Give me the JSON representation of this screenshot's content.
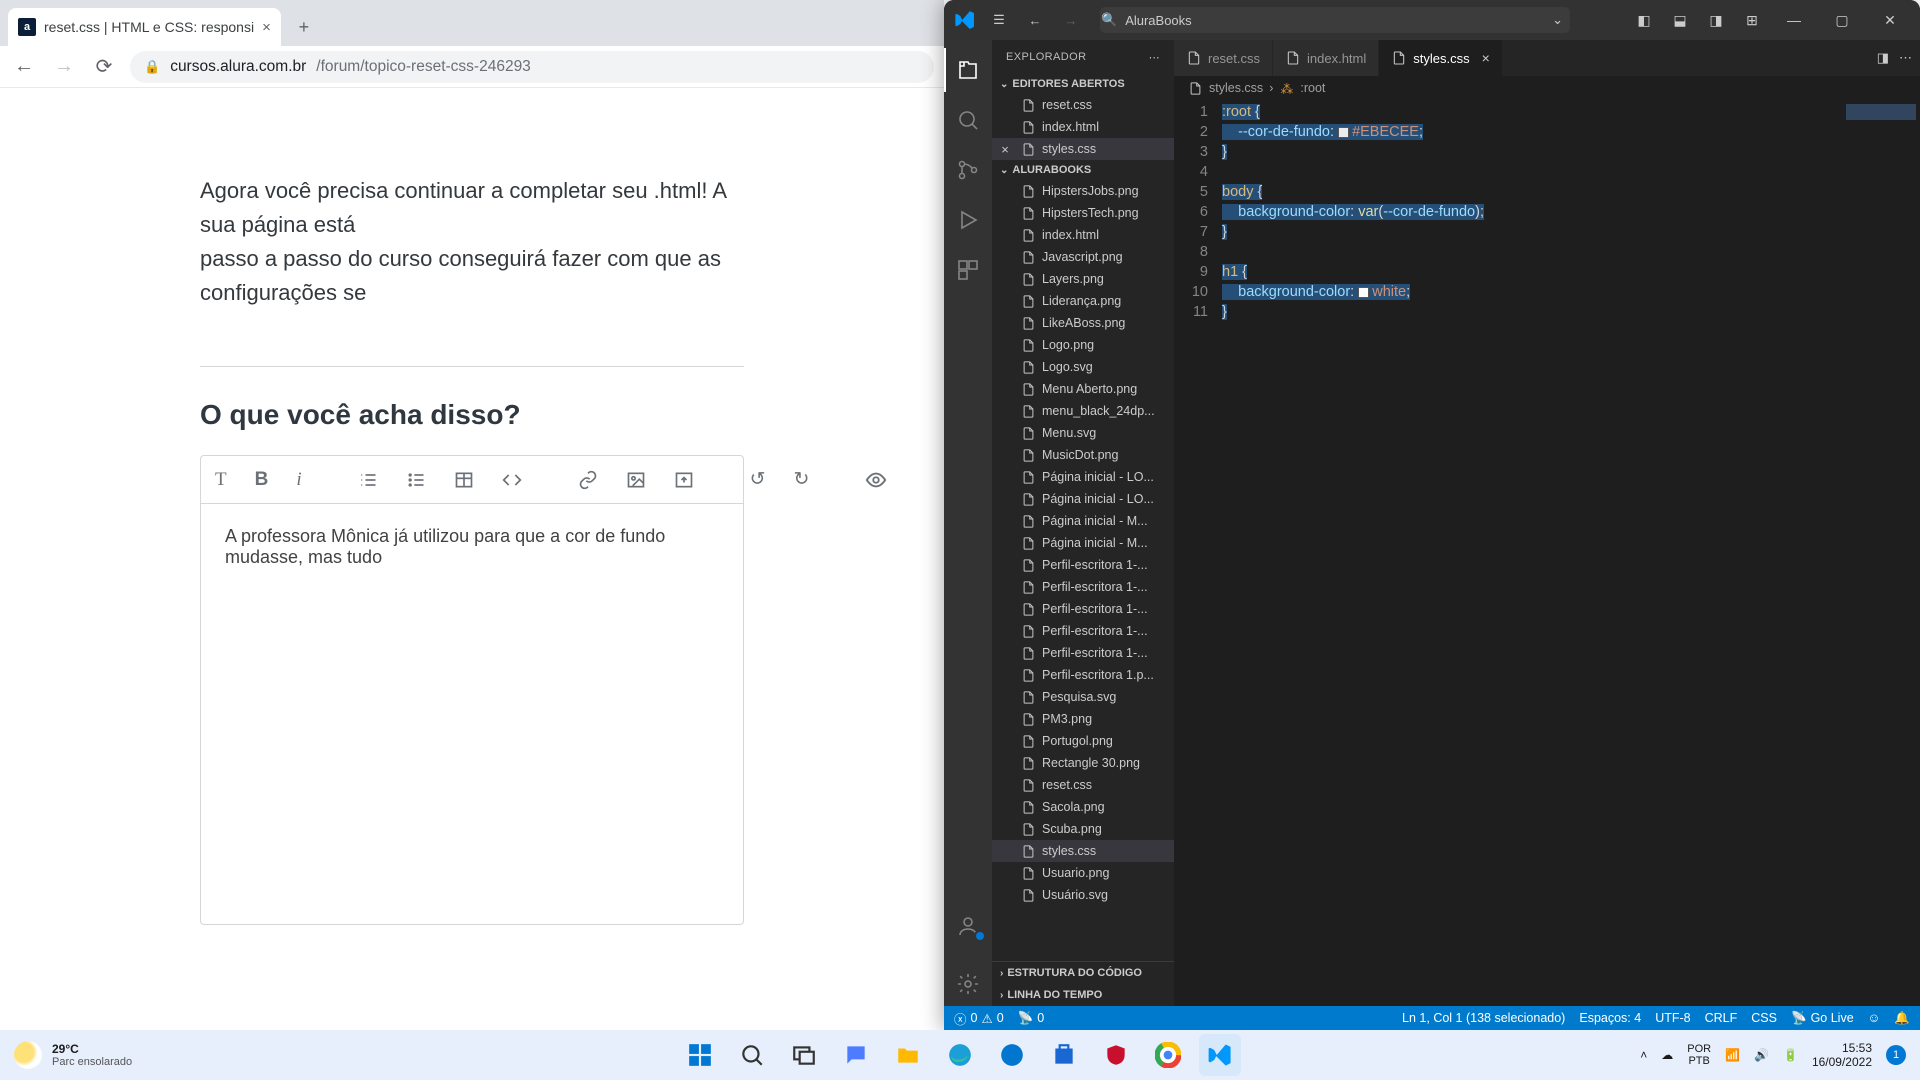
{
  "chrome": {
    "tab_title": "reset.css | HTML e CSS: responsi",
    "favicon_letter": "a",
    "url_host": "cursos.alura.com.br",
    "url_path": "/forum/topico-reset-css-246293"
  },
  "forum": {
    "answer_line1": "Agora você precisa continuar a completar seu .html! A sua página está",
    "answer_line2": "passo a passo do curso conseguirá fazer com que as configurações se",
    "rating_heading": "O que você acha disso?",
    "editor_text": "A professora Mônica já utilizou para que a cor de fundo mudasse, mas tudo"
  },
  "vscode": {
    "project_name": "AluraBooks",
    "titlebar_search": "AluraBooks",
    "explorer_label": "EXPLORADOR",
    "open_editors_label": "EDITORES ABERTOS",
    "project_section_label": "ALURABOOKS",
    "outline_label": "ESTRUTURA DO CÓDIGO",
    "timeline_label": "LINHA DO TEMPO",
    "open_editors": [
      "reset.css",
      "index.html",
      "styles.css"
    ],
    "tree": [
      "HipstersJobs.png",
      "HipstersTech.png",
      "index.html",
      "Javascript.png",
      "Layers.png",
      "Liderança.png",
      "LikeABoss.png",
      "Logo.png",
      "Logo.svg",
      "Menu Aberto.png",
      "menu_black_24dp...",
      "Menu.svg",
      "MusicDot.png",
      "Página inicial - LO...",
      "Página inicial - LO...",
      "Página inicial - M...",
      "Página inicial - M...",
      "Perfil-escritora 1-...",
      "Perfil-escritora 1-...",
      "Perfil-escritora 1-...",
      "Perfil-escritora 1-...",
      "Perfil-escritora 1-...",
      "Perfil-escritora 1.p...",
      "Pesquisa.svg",
      "PM3.png",
      "Portugol.png",
      "Rectangle 30.png",
      "reset.css",
      "Sacola.png",
      "Scuba.png",
      "styles.css",
      "Usuario.png",
      "Usuário.svg"
    ],
    "tabs": [
      {
        "name": "reset.css",
        "active": false
      },
      {
        "name": "index.html",
        "active": false
      },
      {
        "name": "styles.css",
        "active": true
      }
    ],
    "breadcrumb": {
      "file": "styles.css",
      "symbol": ":root"
    },
    "code": {
      "root_prop": "--cor-de-fundo",
      "root_val": "#EBECEE",
      "body_prop": "background-color",
      "body_val_func": "var",
      "body_val_arg": "--cor-de-fundo",
      "h1_prop": "background-color",
      "h1_val": "white"
    },
    "status": {
      "errors": "0",
      "warnings": "0",
      "ports": "0",
      "cursor": "Ln 1, Col 1 (138 selecionado)",
      "spaces": "Espaços: 4",
      "encoding": "UTF-8",
      "eol": "CRLF",
      "lang": "CSS",
      "golive": "Go Live"
    }
  },
  "taskbar": {
    "temp": "29°C",
    "cond": "Parc ensolarado",
    "lang1": "POR",
    "lang2": "PTB",
    "time": "15:53",
    "date": "16/09/2022",
    "badge": "1"
  }
}
